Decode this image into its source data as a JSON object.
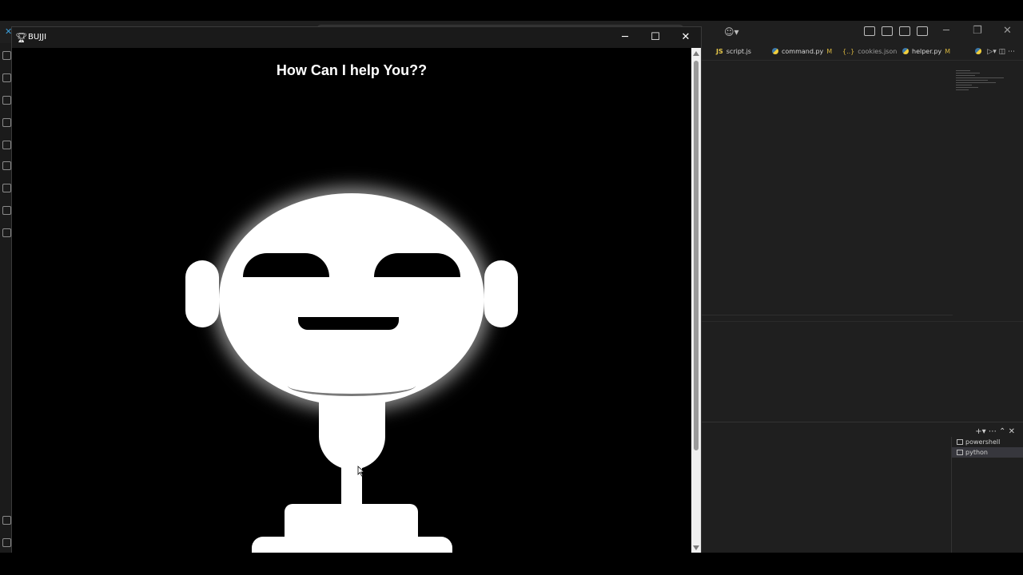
{
  "vscode": {
    "tabs": [
      {
        "label": "script.js",
        "kind": "js",
        "badge_text": "JS",
        "modified": ""
      },
      {
        "label": "command.py",
        "kind": "py",
        "modified": "M"
      },
      {
        "label": "cookies.json",
        "kind": "json",
        "badge_text": "{..}",
        "modified": ""
      },
      {
        "label": "helper.py",
        "kind": "py",
        "modified": "M"
      }
    ],
    "terminals": [
      {
        "label": "powershell",
        "active": false
      },
      {
        "label": "python",
        "active": true
      }
    ]
  },
  "app": {
    "title": "BUJJI",
    "heading": "How Can I help You??",
    "window_buttons": {
      "minimize": "─",
      "maximize": "☐",
      "close": "✕"
    }
  },
  "colors": {
    "app_background": "#000000",
    "robot": "#ffffff",
    "vscode_background": "#1f1f1f"
  }
}
